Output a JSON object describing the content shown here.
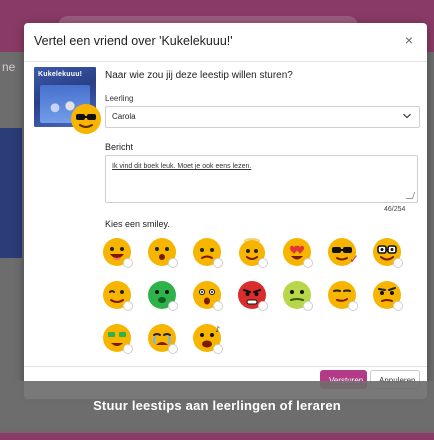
{
  "background": {
    "partial_text_left": "ne",
    "accent": "#8a3a66"
  },
  "modal": {
    "title": "Vertel een vriend over 'Kukelekuuu!'",
    "close_label": "×",
    "book": {
      "cover_title": "Kukelekuuu!"
    },
    "prompt": "Naar wie zou jij deze leestip willen sturen?",
    "recipient": {
      "label": "Leerling",
      "selected": "Carola"
    },
    "message": {
      "label": "Bericht",
      "value": "Ik vind dit boek leuk. Moet je ook eens lezen.",
      "counter": "46/254"
    },
    "smiley_label": "Kies een smiley.",
    "smileys": [
      {
        "name": "laughing-face-icon",
        "selected": false
      },
      {
        "name": "surprised-face-icon",
        "selected": false
      },
      {
        "name": "confused-face-icon",
        "selected": false
      },
      {
        "name": "angel-face-icon",
        "selected": false
      },
      {
        "name": "heart-eyes-face-icon",
        "selected": false
      },
      {
        "name": "sunglasses-face-icon",
        "selected": true
      },
      {
        "name": "nerd-glasses-face-icon",
        "selected": false
      },
      {
        "name": "winking-face-icon",
        "selected": false
      },
      {
        "name": "sick-face-icon",
        "selected": false
      },
      {
        "name": "shocked-face-icon",
        "selected": false
      },
      {
        "name": "angry-face-icon",
        "selected": false
      },
      {
        "name": "nauseated-face-icon",
        "selected": false
      },
      {
        "name": "smirking-face-icon",
        "selected": false
      },
      {
        "name": "skeptical-face-icon",
        "selected": false
      },
      {
        "name": "money-face-icon",
        "selected": false
      },
      {
        "name": "crying-face-icon",
        "selected": false
      },
      {
        "name": "singing-face-icon",
        "selected": false
      }
    ],
    "buttons": {
      "send": "Versturen",
      "cancel": "Annuleren"
    }
  },
  "caption": {
    "text": "Stuur leestips aan leerlingen of leraren"
  },
  "colors": {
    "primary": "#b23a86",
    "emoji_yellow": "#f7b500",
    "emoji_green": "#2fb24a",
    "emoji_red": "#d92c2c"
  }
}
